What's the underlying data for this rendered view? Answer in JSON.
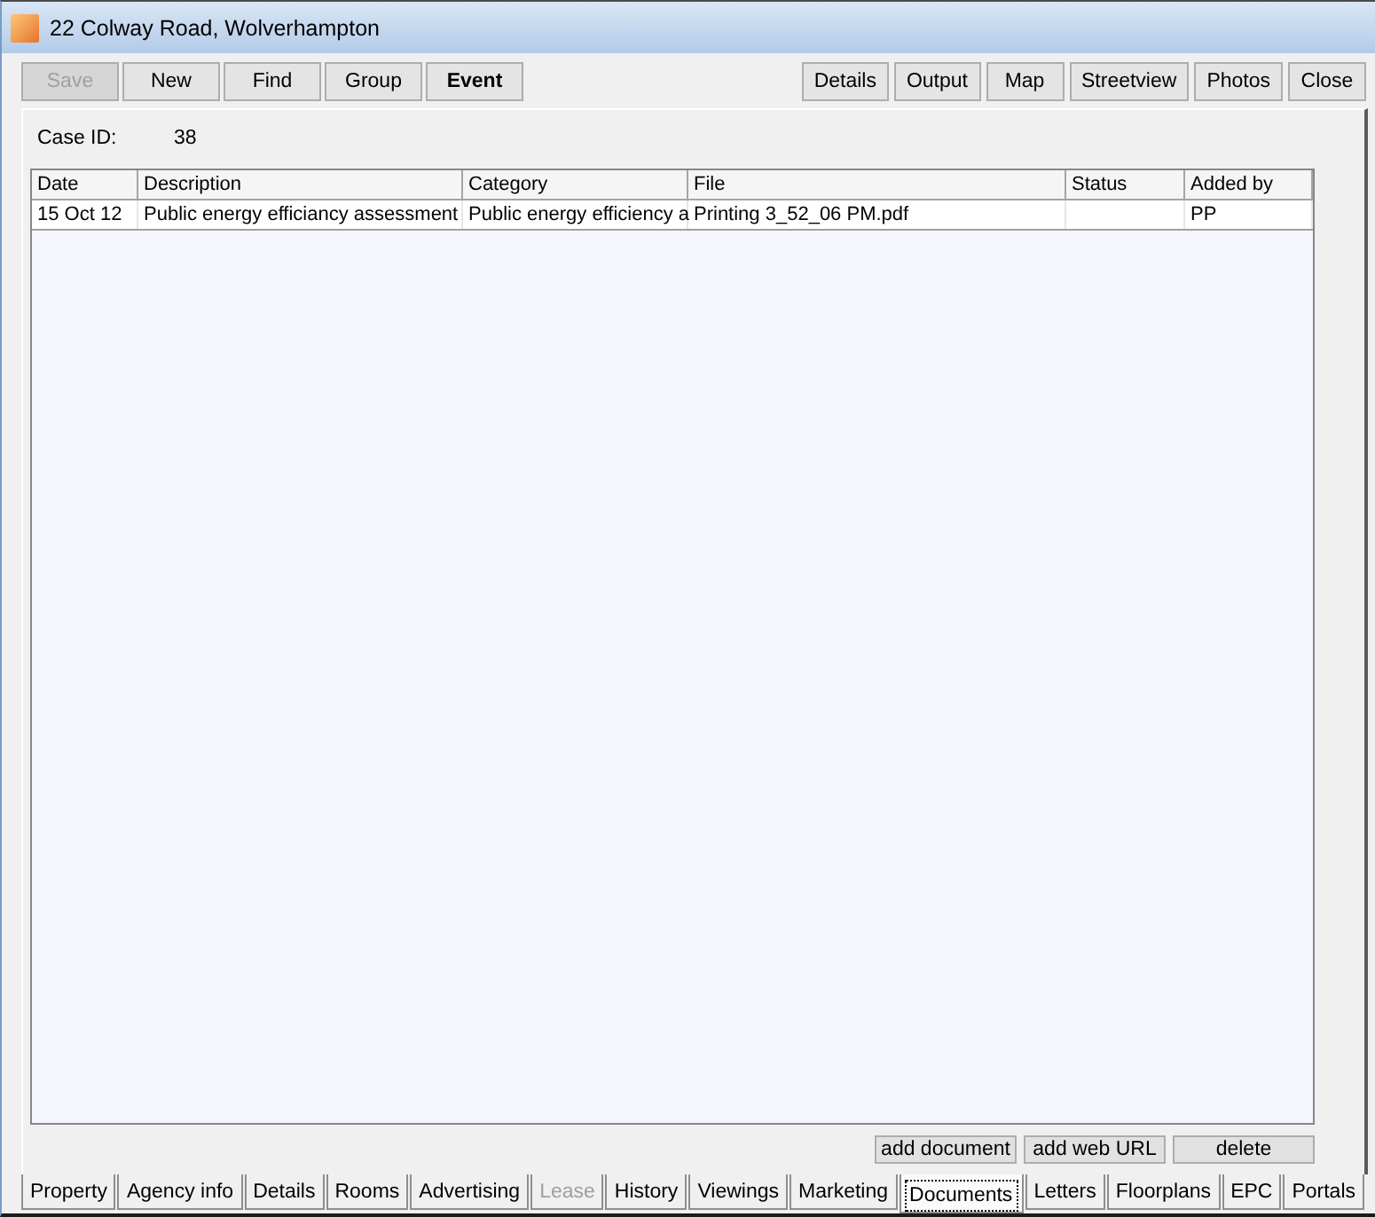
{
  "window": {
    "title": "22 Colway Road, Wolverhampton"
  },
  "toolbar": {
    "left": [
      {
        "label": "Save",
        "disabled": true,
        "emphasized": false
      },
      {
        "label": "New",
        "disabled": false,
        "emphasized": false
      },
      {
        "label": "Find",
        "disabled": false,
        "emphasized": false
      },
      {
        "label": "Group",
        "disabled": false,
        "emphasized": false
      },
      {
        "label": "Event",
        "disabled": false,
        "emphasized": true
      }
    ],
    "right": [
      "Details",
      "Output",
      "Map",
      "Streetview",
      "Photos",
      "Close"
    ]
  },
  "case": {
    "label": "Case ID:",
    "value": "38"
  },
  "table": {
    "columns": [
      "Date",
      "Description",
      "Category",
      "File",
      "Status",
      "Added by"
    ],
    "rows": [
      {
        "cells": [
          "15 Oct 12",
          "Public energy efficiancy assessment",
          "Public energy efficiency a",
          "Printing 3_52_06 PM.pdf",
          null,
          "PP"
        ]
      }
    ]
  },
  "actions": [
    "add document",
    "add web URL",
    "delete"
  ],
  "tabs": [
    {
      "label": "Property",
      "selected": false,
      "disabled": false
    },
    {
      "label": "Agency info",
      "selected": false,
      "disabled": false
    },
    {
      "label": "Details",
      "selected": false,
      "disabled": false
    },
    {
      "label": "Rooms",
      "selected": false,
      "disabled": false
    },
    {
      "label": "Advertising",
      "selected": false,
      "disabled": false
    },
    {
      "label": "Lease",
      "selected": false,
      "disabled": true
    },
    {
      "label": "History",
      "selected": false,
      "disabled": false
    },
    {
      "label": "Viewings",
      "selected": false,
      "disabled": false
    },
    {
      "label": "Marketing",
      "selected": false,
      "disabled": false
    },
    {
      "label": "Documents",
      "selected": true,
      "disabled": false
    },
    {
      "label": "Letters",
      "selected": false,
      "disabled": false
    },
    {
      "label": "Floorplans",
      "selected": false,
      "disabled": false
    },
    {
      "label": "EPC",
      "selected": false,
      "disabled": false
    },
    {
      "label": "Portals",
      "selected": false,
      "disabled": false
    }
  ]
}
